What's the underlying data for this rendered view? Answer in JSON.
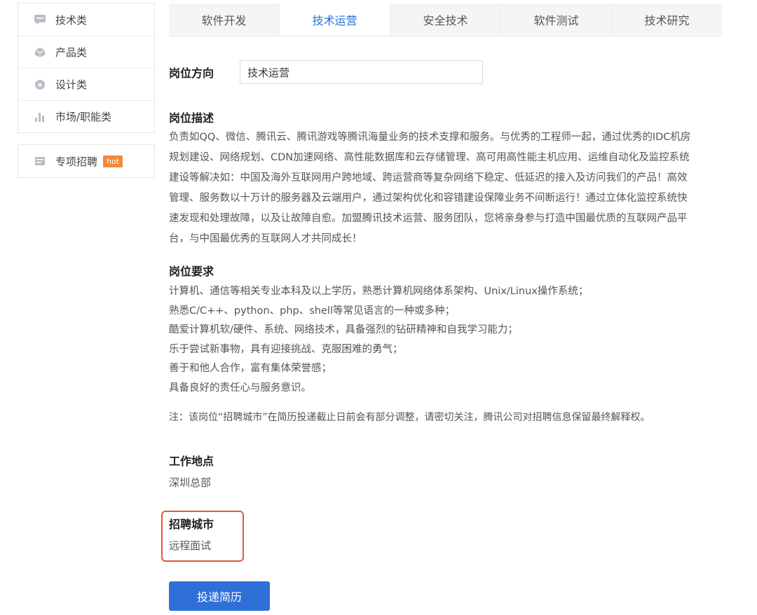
{
  "sidebar": {
    "items": [
      {
        "label": "技术类",
        "icon": "chat-bubble-icon"
      },
      {
        "label": "产品类",
        "icon": "cube-icon"
      },
      {
        "label": "设计类",
        "icon": "palette-icon"
      },
      {
        "label": "市场/职能类",
        "icon": "bar-chart-icon"
      }
    ],
    "special": {
      "label": "专项招聘",
      "icon": "card-icon",
      "badge": "hot"
    }
  },
  "tabs": [
    {
      "label": "软件开发",
      "active": false
    },
    {
      "label": "技术运营",
      "active": true
    },
    {
      "label": "安全技术",
      "active": false
    },
    {
      "label": "软件测试",
      "active": false
    },
    {
      "label": "技术研究",
      "active": false
    }
  ],
  "job": {
    "direction_label": "岗位方向",
    "direction_value": "技术运营",
    "description_title": "岗位描述",
    "description_lines": [
      "负责如QQ、微信、腾讯云、腾讯游戏等腾讯海量业务的技术支撑和服务。与优秀的工程师一起，通过优秀的IDC机房",
      "规划建设、网络规划、CDN加速网络、高性能数据库和云存储管理、高可用高性能主机应用、运维自动化及监控系统",
      "建设等解决如：中国及海外互联网用户跨地域、跨运营商等复杂网络下稳定、低延迟的接入及访问我们的产品！高效",
      "管理、服务数以十万计的服务器及云端用户，通过架构优化和容错建设保障业务不间断运行！通过立体化监控系统快",
      "速发现和处理故障，以及让故障自愈。加盟腾讯技术运营、服务团队，您将亲身参与打造中国最优质的互联网产品平",
      "台，与中国最优秀的互联网人才共同成长！"
    ],
    "requirements_title": "岗位要求",
    "requirements": [
      "计算机、通信等相关专业本科及以上学历，熟悉计算机网络体系架构、Unix/Linux操作系统；",
      "熟悉C/C++、python、php、shell等常见语言的一种或多种；",
      "酷爱计算机软/硬件、系统、网络技术，具备强烈的钻研精神和自我学习能力；",
      "乐于尝试新事物，具有迎接挑战、克服困难的勇气；",
      "善于和他人合作，富有集体荣誉感；",
      "具备良好的责任心与服务意识。"
    ],
    "note": "注：该岗位“招聘城市”在简历投递截止日前会有部分调整，请密切关注，腾讯公司对招聘信息保留最终解释权。",
    "location_title": "工作地点",
    "location_value": "深圳总部",
    "city_title": "招聘城市",
    "city_value": "远程面试",
    "apply_label": "投递简历"
  },
  "colors": {
    "accent": "#2f6fd8",
    "active_tab_text": "#2a6fd6",
    "highlight": "#e05a38",
    "hot_badge": "#f0883e"
  }
}
